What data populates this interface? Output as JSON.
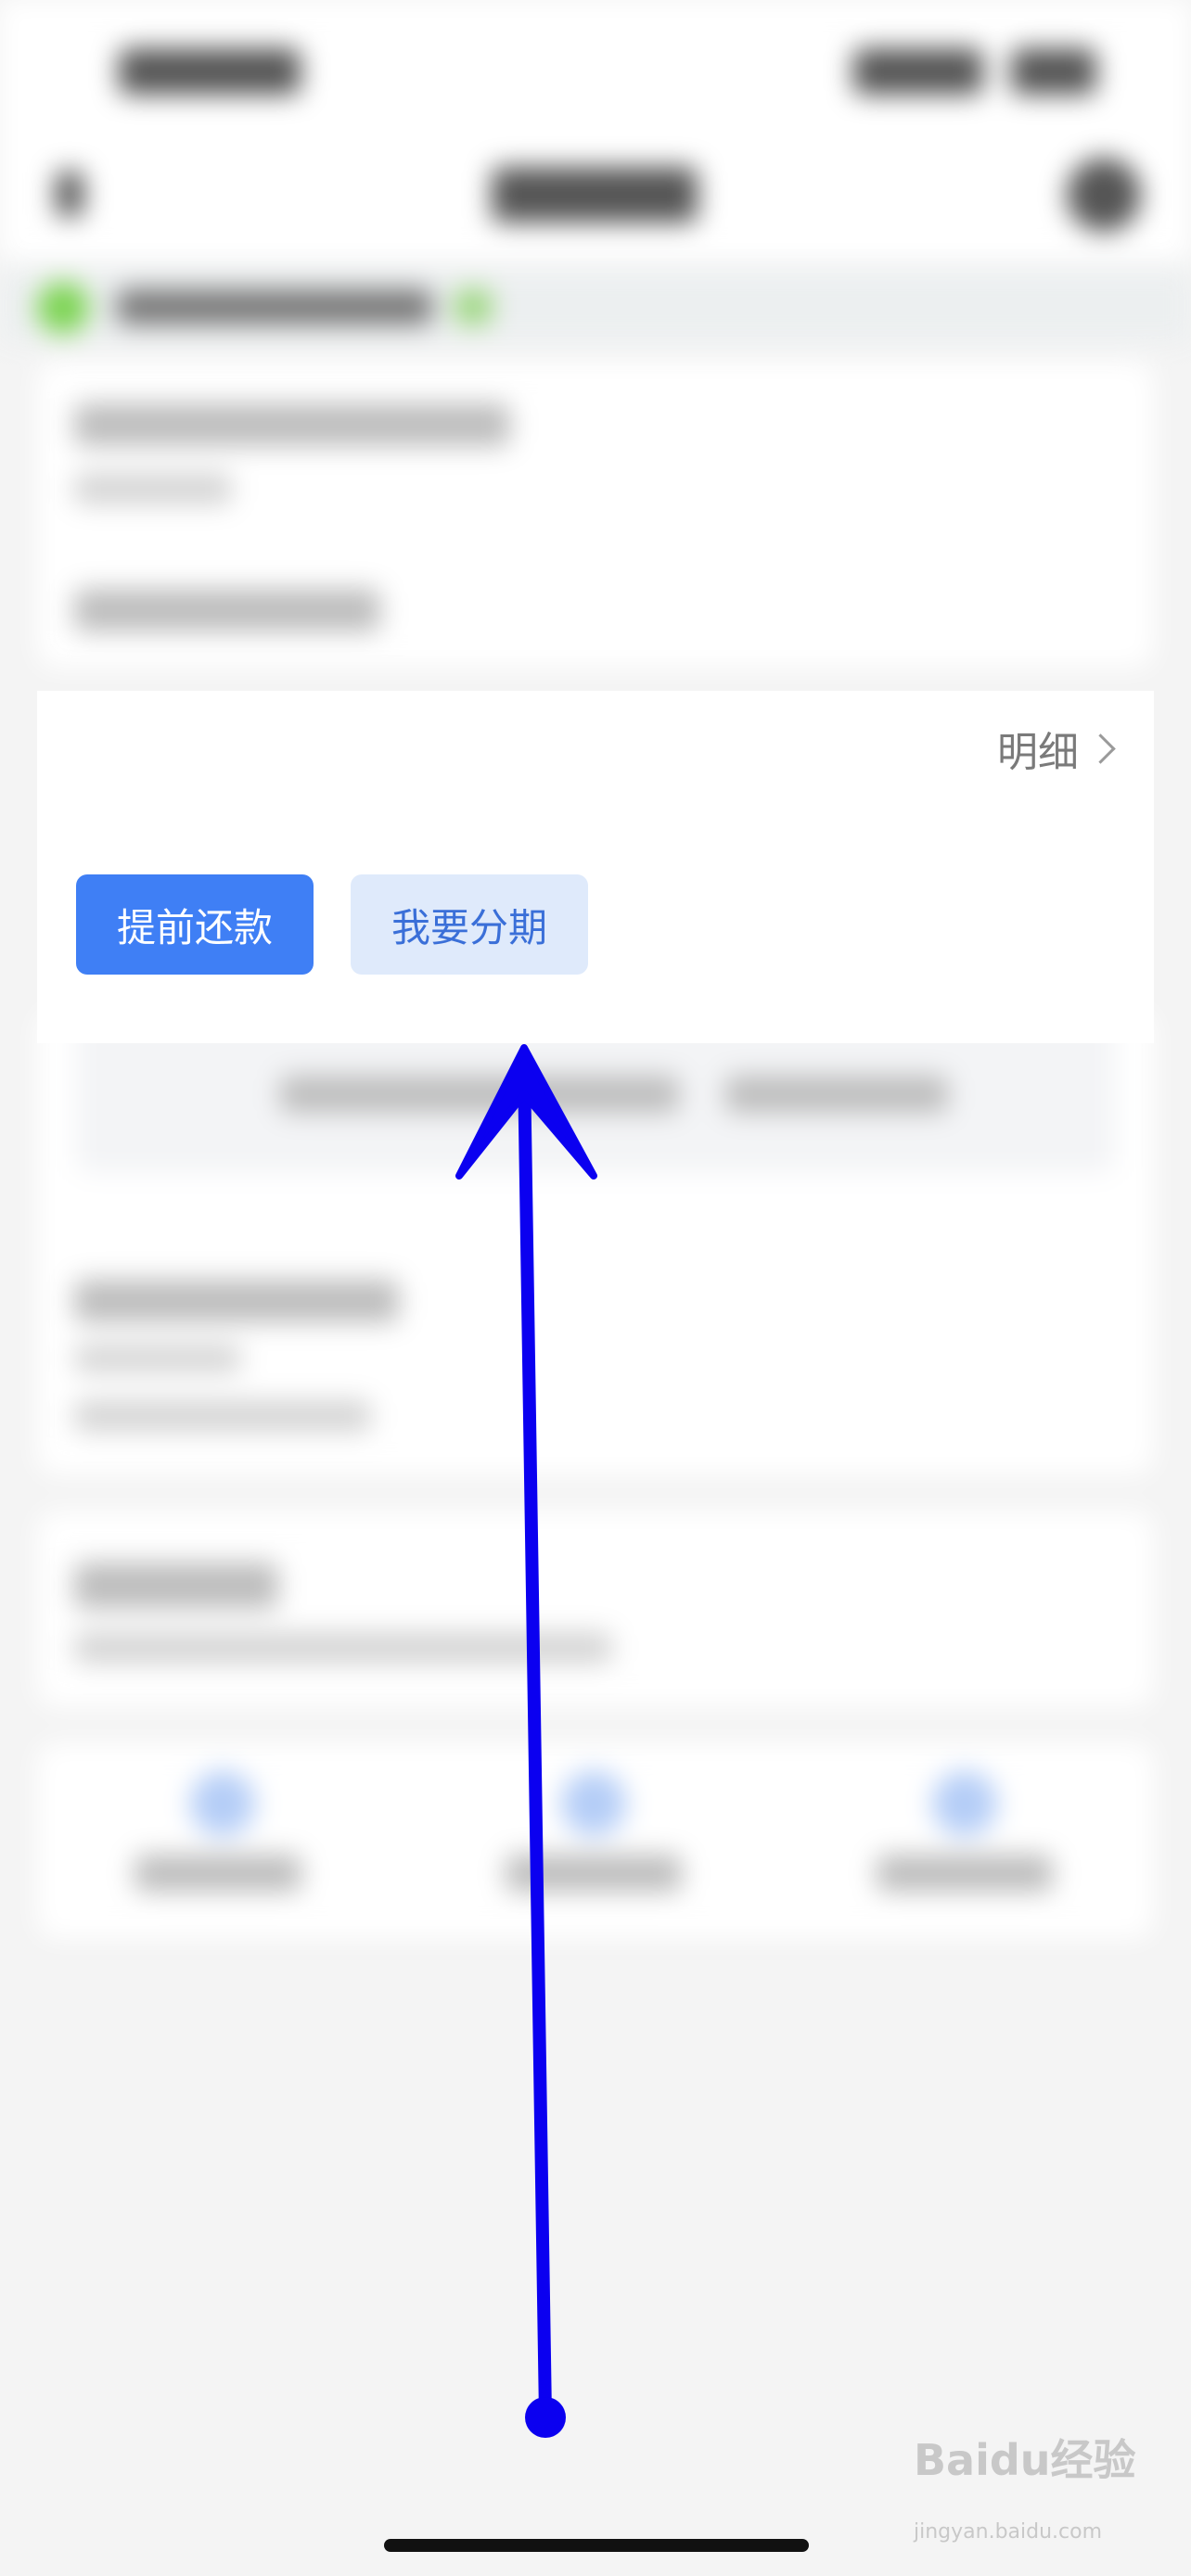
{
  "detail": {
    "label": "明细"
  },
  "actions": {
    "prepay_label": "提前还款",
    "installment_label": "我要分期"
  },
  "watermark": {
    "brand": "Baidu经验",
    "domain": "jingyan.baidu.com"
  },
  "colors": {
    "primary": "#3f7ff5",
    "secondary_bg": "#dfeafb",
    "secondary_text": "#3a6fd8",
    "arrow": "#0b00f0"
  },
  "icons": {
    "detail_chevron": "chevron-right-icon",
    "swipe_arrow": "swipe-up-arrow-icon"
  }
}
